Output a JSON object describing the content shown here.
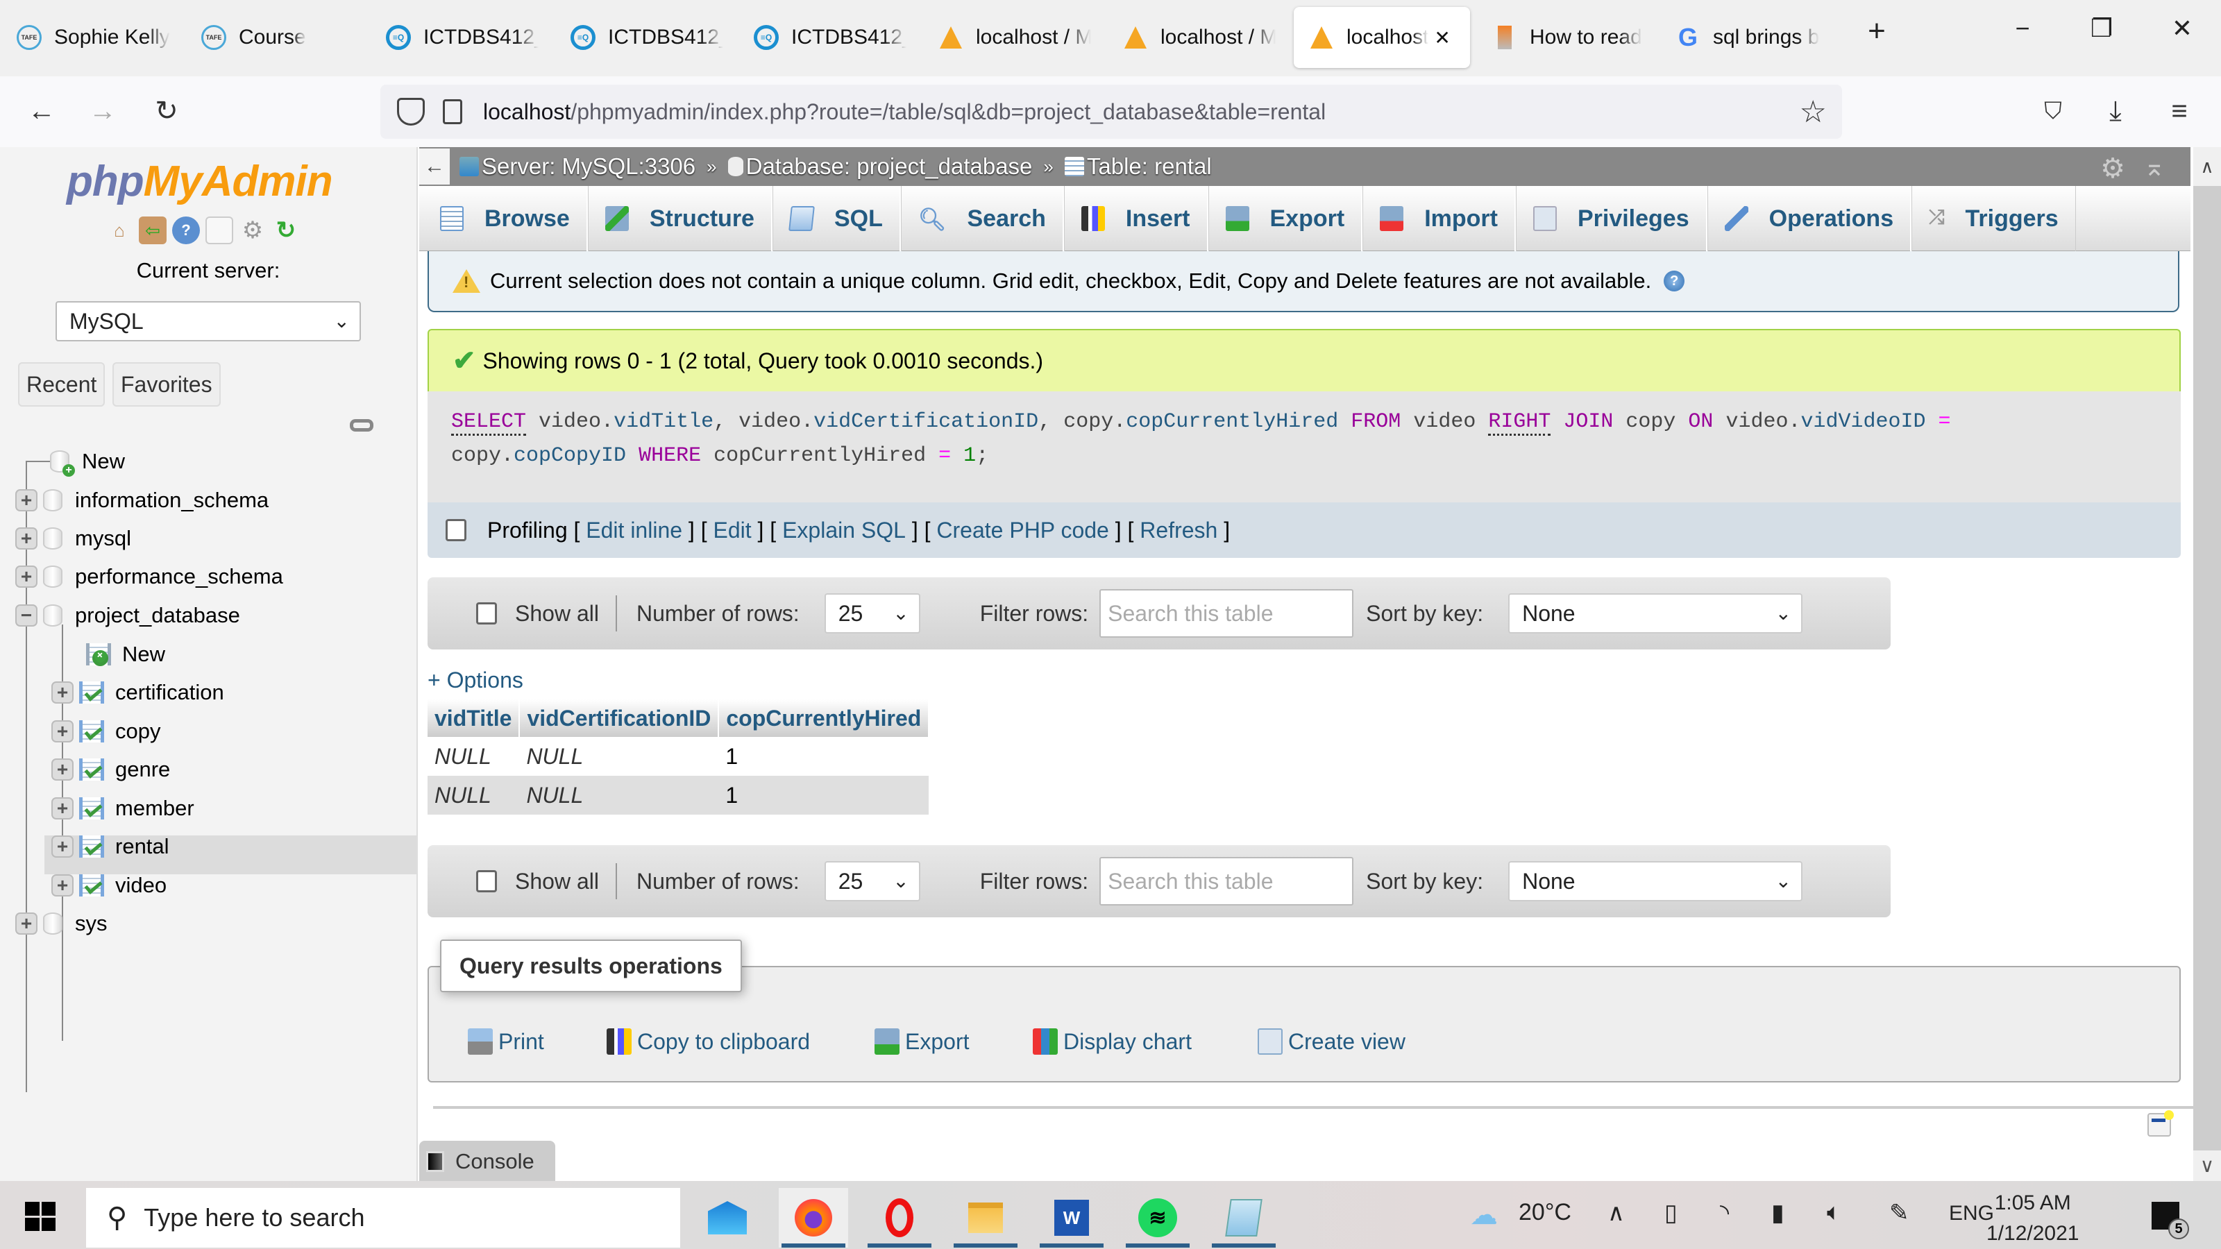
{
  "browser": {
    "tabs": [
      {
        "label": "Sophie Kelly",
        "icon": "tafe-icon",
        "active": false
      },
      {
        "label": "Course",
        "icon": "tafe-icon",
        "active": false
      },
      {
        "label": "ICTDBS412_",
        "icon": "eq-icon",
        "active": false
      },
      {
        "label": "ICTDBS412_",
        "icon": "eq-icon",
        "active": false
      },
      {
        "label": "ICTDBS412_",
        "icon": "eq-icon",
        "active": false
      },
      {
        "label": "localhost / M",
        "icon": "pma-icon",
        "active": false
      },
      {
        "label": "localhost / M",
        "icon": "pma-icon",
        "active": false
      },
      {
        "label": "localhost",
        "icon": "pma-icon",
        "active": true
      },
      {
        "label": "How to read",
        "icon": "stackoverflow-icon",
        "active": false
      },
      {
        "label": "sql brings b",
        "icon": "google-icon",
        "active": false
      }
    ],
    "new_tab": "+",
    "window_controls": {
      "minimize": "−",
      "restore": "❐",
      "close": "✕"
    },
    "tab_close": "✕",
    "url_host": "localhost",
    "url_rest": "/phpmyadmin/index.php?route=/table/sql&db=project_database&table=rental"
  },
  "sidebar": {
    "logo_php": "php",
    "logo_myadmin": "MyAdmin",
    "current_server_label": "Current server:",
    "server_selected": "MySQL",
    "recent_label": "Recent",
    "favorites_label": "Favorites",
    "tree": {
      "new_db": "New",
      "databases": [
        "information_schema",
        "mysql",
        "performance_schema",
        "project_database",
        "sys"
      ],
      "expanded_db": "project_database",
      "new_table": "New",
      "tables": [
        "certification",
        "copy",
        "genre",
        "member",
        "rental",
        "video"
      ],
      "selected_table": "rental"
    }
  },
  "breadcrumb": {
    "server": "Server: MySQL:3306",
    "database": "Database: project_database",
    "table": "Table: rental",
    "separator": "»"
  },
  "menu_tabs": [
    "Browse",
    "Structure",
    "SQL",
    "Search",
    "Insert",
    "Export",
    "Import",
    "Privileges",
    "Operations",
    "Triggers"
  ],
  "notice": "Current selection does not contain a unique column. Grid edit, checkbox, Edit, Copy and Delete features are not available.",
  "success": "Showing rows 0 - 1 (2 total, Query took 0.0010 seconds.)",
  "sql": {
    "line1": [
      {
        "t": "SELECT",
        "c": "kwu"
      },
      {
        "t": " video.",
        "c": ""
      },
      {
        "t": "vidTitle",
        "c": "col"
      },
      {
        "t": ", video.",
        "c": ""
      },
      {
        "t": "vidCertificationID",
        "c": "col"
      },
      {
        "t": ", copy.",
        "c": ""
      },
      {
        "t": "copCurrentlyHired",
        "c": "col"
      },
      {
        "t": " ",
        "c": ""
      },
      {
        "t": "FROM",
        "c": "kw"
      },
      {
        "t": " video ",
        "c": ""
      },
      {
        "t": "RIGHT",
        "c": "kwu"
      },
      {
        "t": " ",
        "c": ""
      },
      {
        "t": "JOIN",
        "c": "kw"
      },
      {
        "t": " copy ",
        "c": ""
      },
      {
        "t": "ON",
        "c": "kw"
      },
      {
        "t": " video.",
        "c": ""
      },
      {
        "t": "vidVideoID",
        "c": "col"
      },
      {
        "t": " ",
        "c": ""
      },
      {
        "t": "=",
        "c": "op"
      }
    ],
    "line2": [
      {
        "t": "copy.",
        "c": ""
      },
      {
        "t": "copCopyID",
        "c": "col"
      },
      {
        "t": " ",
        "c": ""
      },
      {
        "t": "WHERE",
        "c": "kw"
      },
      {
        "t": " copCurrentlyHired ",
        "c": ""
      },
      {
        "t": "=",
        "c": "op"
      },
      {
        "t": " ",
        "c": ""
      },
      {
        "t": "1",
        "c": "num"
      },
      {
        "t": ";",
        "c": ""
      }
    ]
  },
  "profiling": {
    "label": "Profiling",
    "links": [
      "Edit inline",
      "Edit",
      "Explain SQL",
      "Create PHP code",
      "Refresh"
    ]
  },
  "table_nav": {
    "show_all": "Show all",
    "num_rows_label": "Number of rows:",
    "num_rows_value": "25",
    "filter_label": "Filter rows:",
    "filter_placeholder": "Search this table",
    "sort_label": "Sort by key:",
    "sort_value": "None"
  },
  "options_link": "+ Options",
  "results": {
    "columns": [
      "vidTitle",
      "vidCertificationID",
      "copCurrentlyHired"
    ],
    "rows": [
      [
        "NULL",
        "NULL",
        "1"
      ],
      [
        "NULL",
        "NULL",
        "1"
      ]
    ]
  },
  "query_ops": {
    "legend": "Query results operations",
    "links": [
      "Print",
      "Copy to clipboard",
      "Export",
      "Display chart",
      "Create view"
    ]
  },
  "console_label": "Console",
  "taskbar": {
    "search_placeholder": "Type here to search",
    "weather": "20°C",
    "language": "ENG",
    "time": "1:05 AM",
    "date": "1/12/2021",
    "notifications": "5"
  }
}
